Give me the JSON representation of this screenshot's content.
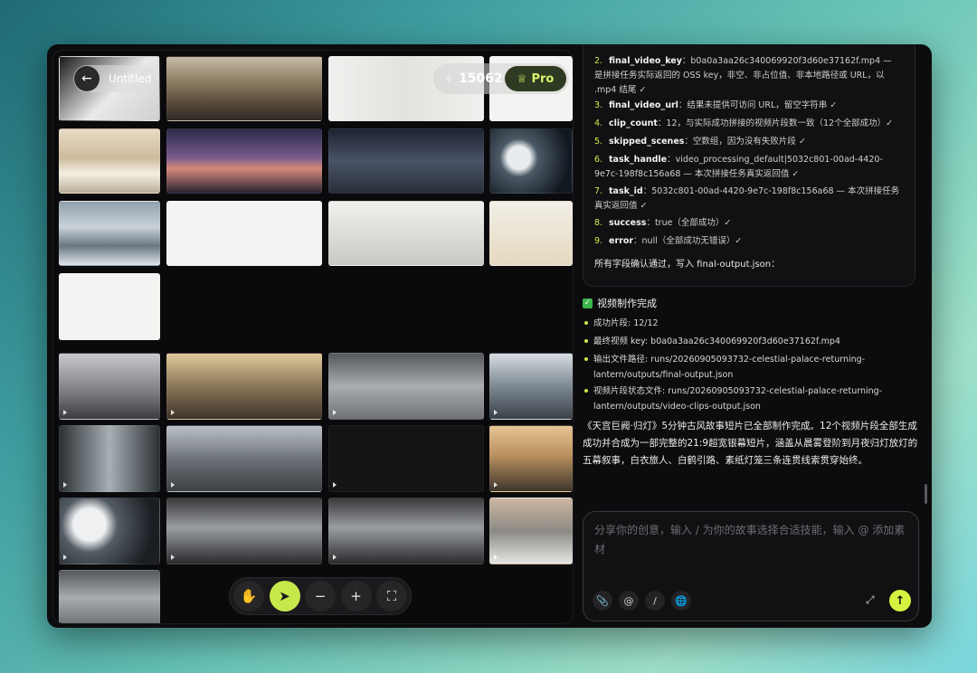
{
  "canvas": {
    "title": "Untitled",
    "credits": "15062",
    "pro_label": "Pro",
    "icons": {
      "back": "arrow-left-icon",
      "credits": "sparkle-icon",
      "pro": "crown-icon"
    },
    "toolbar": {
      "hand": "hand-icon",
      "select": "cursor-icon",
      "zoom_out": "minus-icon",
      "zoom_in": "plus-icon",
      "fit": "fullscreen-icon"
    }
  },
  "chat": {
    "fields": [
      {
        "num": "2.",
        "key": "final_video_key",
        "desc": "：b0a0a3aa26c340069920f3d60e37162f.mp4 — 是拼接任务实际返回的 OSS key，非空、非占位值、非本地路径或 URL，以 .mp4 结尾 ✓"
      },
      {
        "num": "3.",
        "key": "final_video_url",
        "desc": "：结果未提供可访问 URL，留空字符串 ✓"
      },
      {
        "num": "4.",
        "key": "clip_count",
        "desc": "：12，与实际成功拼接的视频片段数一致（12个全部成功）✓"
      },
      {
        "num": "5.",
        "key": "skipped_scenes",
        "desc": "：空数组，因为没有失败片段 ✓"
      },
      {
        "num": "6.",
        "key": "task_handle",
        "desc": "：video_processing_default|5032c801-00ad-4420-9e7c-198f8c156a68 — 本次拼接任务真实返回值 ✓"
      },
      {
        "num": "7.",
        "key": "task_id",
        "desc": "：5032c801-00ad-4420-9e7c-198f8c156a68 — 本次拼接任务真实返回值 ✓"
      },
      {
        "num": "8.",
        "key": "success",
        "desc": "：true（全部成功）✓"
      },
      {
        "num": "9.",
        "key": "error",
        "desc": "：null（全部成功无错误）✓"
      }
    ],
    "confirm": "所有字段确认通过，写入 final-output.json：",
    "done_title": "视频制作完成",
    "bullets": [
      "成功片段: 12/12",
      "最终视频 key: b0a0a3aa26c340069920f3d60e37162f.mp4",
      "输出文件路径: runs/20260905093732-celestial-palace-returning-lantern/outputs/final-output.json",
      "视频片段状态文件: runs/20260905093732-celestial-palace-returning-lantern/outputs/video-clips-output.json"
    ],
    "summary": "《天宫巨阙·归灯》5分钟古风故事短片已全部制作完成。12个视频片段全部生成成功并合成为一部完整的21:9超宽银幕短片，涵盖从晨雾登阶到月夜归灯放灯的五幕叙事，白衣旅人、白鹤引路、素纸灯笼三条连贯线索贯穿始终。",
    "input_placeholder": "分享你的创意，输入 / 为你的故事选择合适技能，输入 @ 添加素材",
    "input_icons": [
      "paperclip-icon",
      "at-icon",
      "slash-icon",
      "globe-icon",
      "expand-icon",
      "send-arrow-up-icon"
    ]
  }
}
